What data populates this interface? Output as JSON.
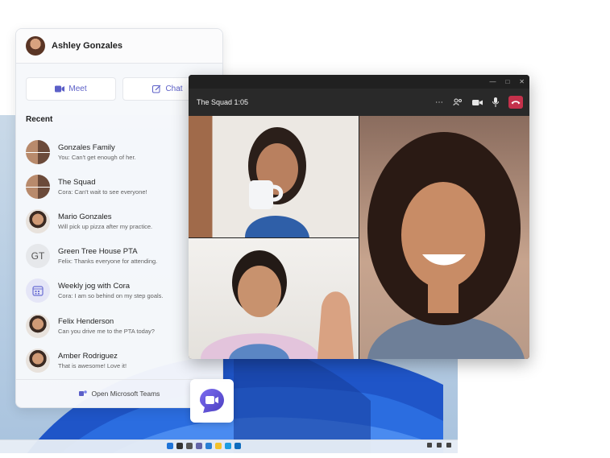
{
  "panel": {
    "user_name": "Ashley Gonzales",
    "meet_label": "Meet",
    "chat_label": "Chat",
    "recent_label": "Recent",
    "footer_label": "Open Microsoft Teams",
    "items": [
      {
        "name": "Gonzales Family",
        "preview": "You: Can't get enough of her."
      },
      {
        "name": "The Squad",
        "preview": "Cora: Can't wait to see everyone!"
      },
      {
        "name": "Mario Gonzales",
        "preview": "Will pick up pizza after my practice."
      },
      {
        "name": "Green Tree House PTA",
        "preview": "Felix: Thanks everyone for attending.",
        "initials": "GT"
      },
      {
        "name": "Weekly jog with Cora",
        "preview": "Cora: I am so behind on my step goals."
      },
      {
        "name": "Felix Henderson",
        "preview": "Can you drive me to the PTA today?"
      },
      {
        "name": "Amber Rodriguez",
        "preview": "That is awesome! Love it!"
      }
    ]
  },
  "call": {
    "title": "The Squad 1:05",
    "more_icon": "more-icon",
    "participants_icon": "participants-icon",
    "camera_icon": "camera-icon",
    "mic_icon": "mic-icon",
    "hangup_icon": "hangup-icon"
  },
  "colors": {
    "accent": "#5b5fc7",
    "hangup": "#c4314b"
  }
}
